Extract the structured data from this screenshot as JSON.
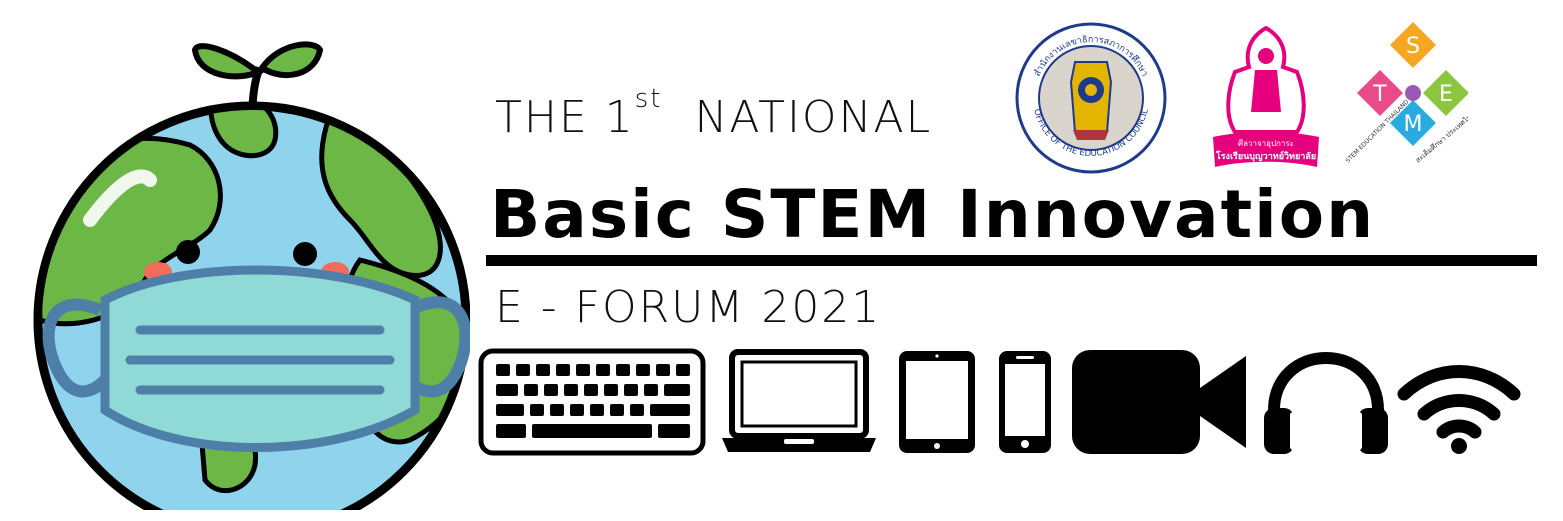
{
  "banner": {
    "line1_prefix": "THE 1",
    "line1_sup": "st",
    "line1_suffix": "NATIONAL",
    "main_title": "Basic STEM Innovation",
    "subtitle": "E - FORUM 2021"
  },
  "logos": {
    "education_council": {
      "ring_top": "สำนักงานเลขาธิการสภาการศึกษา",
      "ring_bottom": "OFFICE OF THE EDUCATION COUNCIL"
    },
    "school": {
      "motto": "ศีลวาจาอุปการะ",
      "name": "โรงเรียนบุญวาทย์วิทยาลัย"
    },
    "stem": {
      "letter_s": "S",
      "letter_t": "T",
      "letter_e": "E",
      "letter_m": "M",
      "caption_en": "STEM EDUCATION THAILAND",
      "caption_th": "สะเต็มศึกษา ประเทศไทย"
    }
  },
  "icons": [
    "globe-mascot-icon",
    "keyboard-icon",
    "laptop-icon",
    "tablet-icon",
    "smartphone-icon",
    "video-camera-icon",
    "headphones-icon",
    "wifi-icon"
  ],
  "colors": {
    "ocean": "#8fd3ec",
    "land": "#6cb745",
    "mask": "#8fd9d6",
    "outline": "#000000",
    "school_pink": "#e6007e",
    "council_blue": "#1f3a8a"
  }
}
